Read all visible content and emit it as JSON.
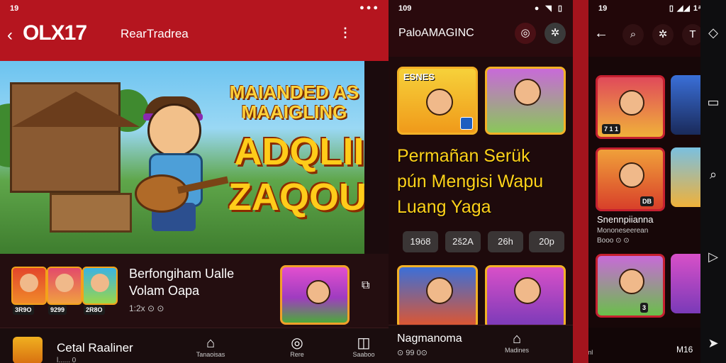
{
  "panel1": {
    "status": {
      "time": "19",
      "icons": "●●●"
    },
    "logo": "OLX17",
    "app_name": "RearTradrea",
    "hero": {
      "title_top": "MAIANDED AS MAAIGLING",
      "title_big": "ADQLII ZAQOUDI"
    },
    "info": {
      "thumbs": [
        {
          "tag": "3R9O"
        },
        {
          "tag": "9299"
        },
        {
          "tag": "2R8O"
        }
      ],
      "title_line1": "Berfongiham Ualle",
      "title_line2": "Volam Oapa",
      "meta": "1:2x ⊙ ⊙"
    },
    "bottom": {
      "game_title": "Cetal Raaliner",
      "game_sub": "l...... 0",
      "nav": [
        {
          "icon": "home-icon",
          "label": "Tanaoisas"
        },
        {
          "icon": "refresh-icon",
          "label": "Rere"
        },
        {
          "icon": "bookmark-icon",
          "label": "Saaboo"
        }
      ]
    }
  },
  "panel2": {
    "status": {
      "time": "109"
    },
    "app_name": "PaloAMAGINC",
    "cards_top": [
      {
        "label": "ESNES"
      },
      {
        "label": ""
      }
    ],
    "promo_lines": [
      "Permañan Serük",
      "pún Mengisi Wapu",
      "Luang Yaga"
    ],
    "chips": [
      "19ö8",
      "2š2A",
      "26h",
      "20p"
    ],
    "bottom": {
      "title": "Nagmanoma",
      "sub": "⊙ 99 0⊙",
      "nav": [
        {
          "icon": "home-icon",
          "label": "Madines"
        }
      ]
    }
  },
  "panel3": {
    "status": {
      "time": "19",
      "icons": "▯ ◢◢ 1ᵃ81G"
    },
    "cards": [
      {
        "tag": "7 1 1"
      },
      {
        "tag": "DB"
      },
      {
        "tag": "3"
      }
    ],
    "title": "Snennpiianna",
    "sub": "Mononeseerean",
    "meta": "Booo ⊙ ⊙",
    "bottom": {
      "nav": [
        {
          "icon": "home-icon",
          "label": "Somlenl"
        }
      ],
      "extra": "M16"
    }
  },
  "rail": {
    "icons": [
      "diamond-icon",
      "crop-icon",
      "search-icon",
      "play-icon",
      "send-icon"
    ]
  },
  "colors": {
    "brand_red": "#b5151f",
    "accent_gold": "#f3b126",
    "promo_yellow": "#ffd21a"
  }
}
